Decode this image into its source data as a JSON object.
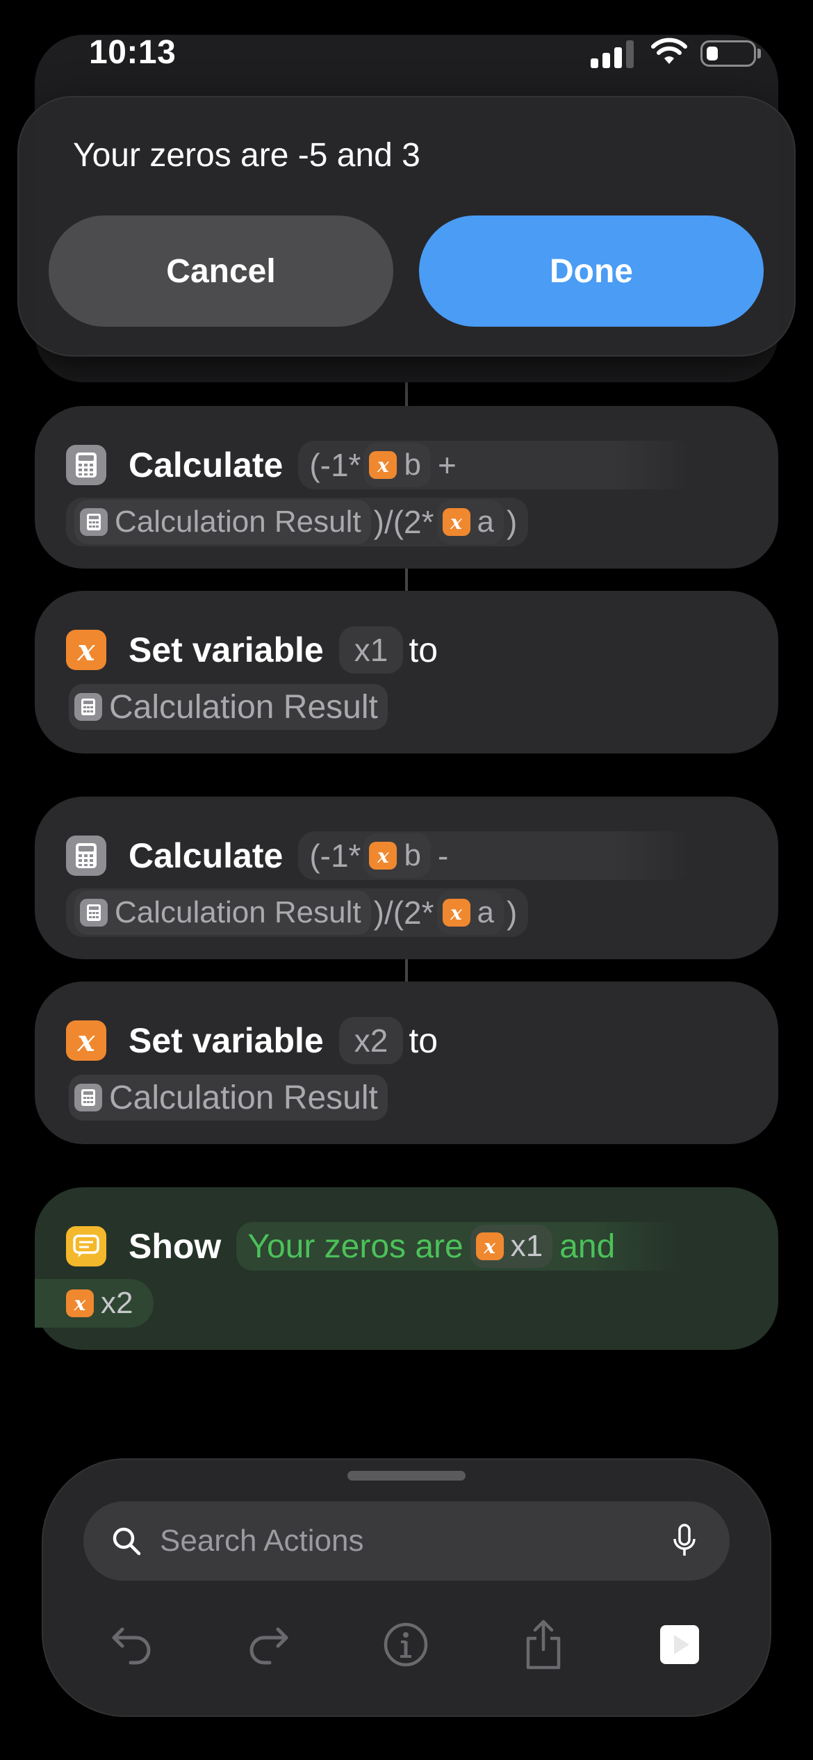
{
  "status": {
    "time": "10:13"
  },
  "alert": {
    "message": "Your zeros are -5 and 3",
    "cancel_label": "Cancel",
    "done_label": "Done"
  },
  "actions": {
    "calc1": {
      "verb": "Calculate",
      "line1_open": "(-1*",
      "var_b": "b",
      "op": "+",
      "token": "Calculation Result",
      "line2_mid": ")/(2*",
      "var_a": "a",
      "line2_close": ")"
    },
    "setvar1": {
      "verb": "Set variable",
      "name": "x1",
      "to": "to",
      "token": "Calculation Result"
    },
    "calc2": {
      "verb": "Calculate",
      "line1_open": "(-1*",
      "var_b": "b",
      "op": "-",
      "token": "Calculation Result",
      "line2_mid": ")/(2*",
      "var_a": "a",
      "line2_close": ")"
    },
    "setvar2": {
      "verb": "Set variable",
      "name": "x2",
      "to": "to",
      "token": "Calculation Result"
    },
    "show": {
      "verb": "Show",
      "text1": "Your zeros are",
      "var1": "x1",
      "text2": "and",
      "var2": "x2"
    }
  },
  "panel": {
    "search_placeholder": "Search Actions"
  },
  "icons": {
    "variable_glyph": "x",
    "colors": {
      "accent": "#4a9cf5",
      "variable": "#f0882f",
      "show": "#f4b82c",
      "green_text": "#4cc15a"
    }
  }
}
